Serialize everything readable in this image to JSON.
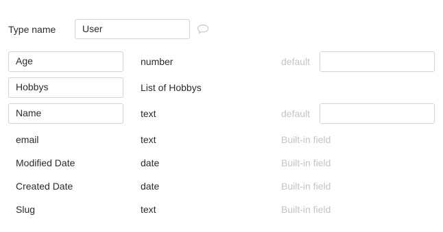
{
  "type_name": {
    "label": "Type name",
    "value": "User"
  },
  "icons": {
    "comment": "speech-bubble-icon"
  },
  "fields": [
    {
      "name": "Age",
      "type": "number",
      "extra": "default",
      "default_value": "",
      "editable": true
    },
    {
      "name": "Hobbys",
      "type": "List of Hobbys",
      "extra": "",
      "default_value": null,
      "editable": true
    },
    {
      "name": "Name",
      "type": "text",
      "extra": "default",
      "default_value": "",
      "editable": true
    },
    {
      "name": "email",
      "type": "text",
      "extra": "Built-in field",
      "default_value": null,
      "editable": false
    },
    {
      "name": "Modified Date",
      "type": "date",
      "extra": "Built-in field",
      "default_value": null,
      "editable": false
    },
    {
      "name": "Created Date",
      "type": "date",
      "extra": "Built-in field",
      "default_value": null,
      "editable": false
    },
    {
      "name": "Slug",
      "type": "text",
      "extra": "Built-in field",
      "default_value": null,
      "editable": false
    }
  ]
}
